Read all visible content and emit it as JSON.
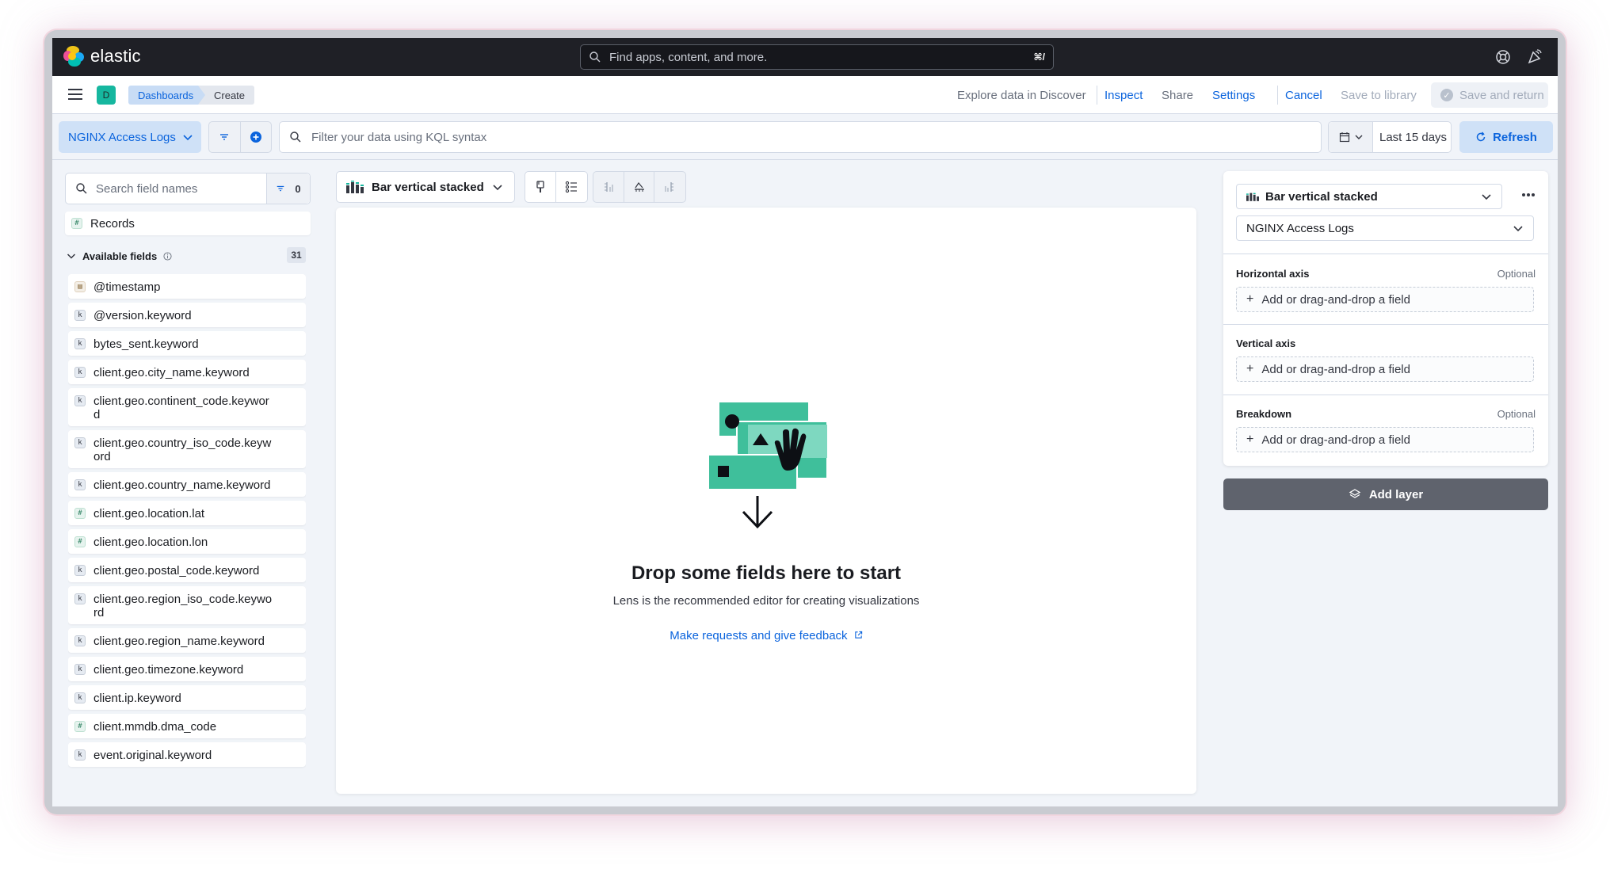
{
  "topbar": {
    "brand": "elastic",
    "search_placeholder": "Find apps, content, and more.",
    "search_shortcut": "⌘/",
    "icons": [
      "help-icon",
      "newsfeed-icon"
    ]
  },
  "navbar": {
    "space_initial": "D",
    "breadcrumbs": [
      "Dashboards",
      "Create"
    ],
    "links": {
      "explore": "Explore data in Discover",
      "inspect": "Inspect",
      "share": "Share",
      "settings": "Settings",
      "cancel": "Cancel",
      "save_library": "Save to library",
      "save_return": "Save and return"
    }
  },
  "querybar": {
    "data_view": "NGINX Access Logs",
    "kql_placeholder": "Filter your data using KQL syntax",
    "date_range": "Last 15 days",
    "refresh_label": "Refresh"
  },
  "sidebar": {
    "search_placeholder": "Search field names",
    "filter_count": "0",
    "records_label": "Records",
    "available_label": "Available fields",
    "available_count": "31",
    "fields": [
      {
        "name": "@timestamp",
        "type": "date"
      },
      {
        "name": "@version.keyword",
        "type": "k"
      },
      {
        "name": "bytes_sent.keyword",
        "type": "k"
      },
      {
        "name": "client.geo.city_name.keyword",
        "type": "k"
      },
      {
        "name": "client.geo.continent_code.keyword",
        "type": "k"
      },
      {
        "name": "client.geo.country_iso_code.keyword",
        "type": "k"
      },
      {
        "name": "client.geo.country_name.keyword",
        "type": "k"
      },
      {
        "name": "client.geo.location.lat",
        "type": "#"
      },
      {
        "name": "client.geo.location.lon",
        "type": "#"
      },
      {
        "name": "client.geo.postal_code.keyword",
        "type": "k"
      },
      {
        "name": "client.geo.region_iso_code.keyword",
        "type": "k"
      },
      {
        "name": "client.geo.region_name.keyword",
        "type": "k"
      },
      {
        "name": "client.geo.timezone.keyword",
        "type": "k"
      },
      {
        "name": "client.ip.keyword",
        "type": "k"
      },
      {
        "name": "client.mmdb.dma_code",
        "type": "#"
      },
      {
        "name": "event.original.keyword",
        "type": "k"
      }
    ]
  },
  "workspace": {
    "chart_type": "Bar vertical stacked",
    "empty_title": "Drop some fields here to start",
    "empty_subtitle": "Lens is the recommended editor for creating visualizations",
    "feedback_link": "Make requests and give feedback"
  },
  "config": {
    "chart_type": "Bar vertical stacked",
    "data_view": "NGINX Access Logs",
    "sections": [
      {
        "label": "Horizontal axis",
        "optional": "Optional",
        "placeholder": "Add or drag-and-drop a field"
      },
      {
        "label": "Vertical axis",
        "optional": "",
        "placeholder": "Add or drag-and-drop a field"
      },
      {
        "label": "Breakdown",
        "optional": "Optional",
        "placeholder": "Add or drag-and-drop a field"
      }
    ],
    "add_layer": "Add layer"
  },
  "colors": {
    "accent": "#0b64dd",
    "topbar": "#1f2026",
    "illustration_teal": "#3fbf9b"
  }
}
